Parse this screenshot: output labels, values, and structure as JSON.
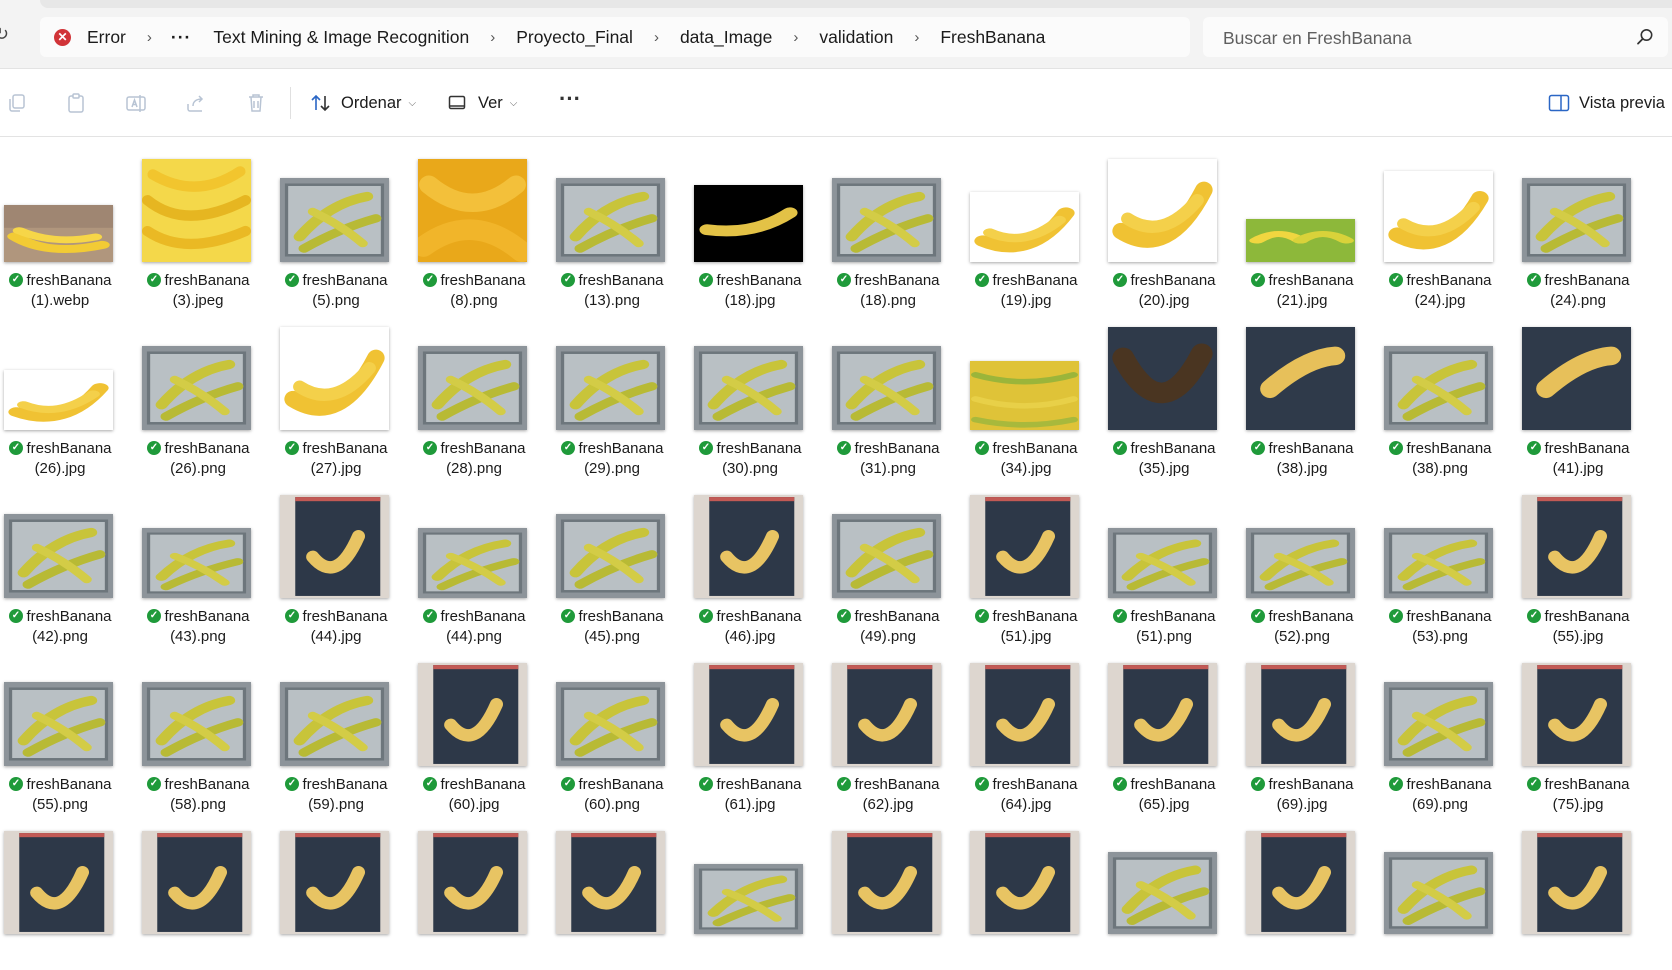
{
  "address_bar": {
    "error_label": "Error",
    "overflow": "···",
    "crumbs": [
      "Text Mining & Image Recognition",
      "Proyecto_Final",
      "data_Image",
      "validation",
      "FreshBanana"
    ]
  },
  "search": {
    "placeholder": "Buscar en FreshBanana"
  },
  "toolbar": {
    "sort_label": "Ordenar",
    "view_label": "Ver",
    "more_label": "···",
    "preview_label": "Vista previa"
  },
  "files": [
    {
      "n1": "freshBanana",
      "n2": "(1).webp",
      "type": "wood",
      "h": 0.55
    },
    {
      "n1": "freshBanana",
      "n2": "(3).jpeg",
      "type": "bunch",
      "h": 1
    },
    {
      "n1": "freshBanana",
      "n2": "(5).png",
      "type": "tray",
      "h": 0.82
    },
    {
      "n1": "freshBanana",
      "n2": "(8).png",
      "type": "closeup",
      "h": 1
    },
    {
      "n1": "freshBanana",
      "n2": "(13).png",
      "type": "tray",
      "h": 0.82
    },
    {
      "n1": "freshBanana",
      "n2": "(18).jpg",
      "type": "black",
      "h": 0.75
    },
    {
      "n1": "freshBanana",
      "n2": "(18).png",
      "type": "tray",
      "h": 0.82
    },
    {
      "n1": "freshBanana",
      "n2": "(19).jpg",
      "type": "white",
      "h": 0.68
    },
    {
      "n1": "freshBanana",
      "n2": "(20).jpg",
      "type": "white",
      "h": 1
    },
    {
      "n1": "freshBanana",
      "n2": "(21).jpg",
      "type": "green",
      "h": 0.42
    },
    {
      "n1": "freshBanana",
      "n2": "(24).jpg",
      "type": "white",
      "h": 0.88
    },
    {
      "n1": "freshBanana",
      "n2": "(24).png",
      "type": "tray",
      "h": 0.82
    },
    {
      "n1": "freshBanana",
      "n2": "(26).jpg",
      "type": "white",
      "h": 0.58
    },
    {
      "n1": "freshBanana",
      "n2": "(26).png",
      "type": "tray",
      "h": 0.82
    },
    {
      "n1": "freshBanana",
      "n2": "(27).jpg",
      "type": "white",
      "h": 1
    },
    {
      "n1": "freshBanana",
      "n2": "(28).png",
      "type": "tray",
      "h": 0.82
    },
    {
      "n1": "freshBanana",
      "n2": "(29).png",
      "type": "tray",
      "h": 0.82
    },
    {
      "n1": "freshBanana",
      "n2": "(30).png",
      "type": "tray",
      "h": 0.82
    },
    {
      "n1": "freshBanana",
      "n2": "(31).png",
      "type": "tray",
      "h": 0.82
    },
    {
      "n1": "freshBanana",
      "n2": "(34).jpg",
      "type": "pile",
      "h": 0.67
    },
    {
      "n1": "freshBanana",
      "n2": "(35).jpg",
      "type": "darkripe",
      "h": 1
    },
    {
      "n1": "freshBanana",
      "n2": "(38).jpg",
      "type": "dark",
      "h": 1
    },
    {
      "n1": "freshBanana",
      "n2": "(38).png",
      "type": "tray",
      "h": 0.82
    },
    {
      "n1": "freshBanana",
      "n2": "(41).jpg",
      "type": "dark",
      "h": 1
    },
    {
      "n1": "freshBanana",
      "n2": "(42).png",
      "type": "tray",
      "h": 0.82
    },
    {
      "n1": "freshBanana",
      "n2": "(43).png",
      "type": "tray",
      "h": 0.68
    },
    {
      "n1": "freshBanana",
      "n2": "(44).jpg",
      "type": "notebook",
      "h": 1
    },
    {
      "n1": "freshBanana",
      "n2": "(44).png",
      "type": "tray",
      "h": 0.68
    },
    {
      "n1": "freshBanana",
      "n2": "(45).png",
      "type": "tray",
      "h": 0.82
    },
    {
      "n1": "freshBanana",
      "n2": "(46).jpg",
      "type": "notebook",
      "h": 1
    },
    {
      "n1": "freshBanana",
      "n2": "(49).png",
      "type": "tray",
      "h": 0.82
    },
    {
      "n1": "freshBanana",
      "n2": "(51).jpg",
      "type": "notebook",
      "h": 1
    },
    {
      "n1": "freshBanana",
      "n2": "(51).png",
      "type": "tray",
      "h": 0.68
    },
    {
      "n1": "freshBanana",
      "n2": "(52).png",
      "type": "tray",
      "h": 0.68
    },
    {
      "n1": "freshBanana",
      "n2": "(53).png",
      "type": "tray",
      "h": 0.68
    },
    {
      "n1": "freshBanana",
      "n2": "(55).jpg",
      "type": "notebook",
      "h": 1
    },
    {
      "n1": "freshBanana",
      "n2": "(55).png",
      "type": "tray",
      "h": 0.82
    },
    {
      "n1": "freshBanana",
      "n2": "(58).png",
      "type": "tray",
      "h": 0.82
    },
    {
      "n1": "freshBanana",
      "n2": "(59).png",
      "type": "tray",
      "h": 0.82
    },
    {
      "n1": "freshBanana",
      "n2": "(60).jpg",
      "type": "notebook",
      "h": 1
    },
    {
      "n1": "freshBanana",
      "n2": "(60).png",
      "type": "tray",
      "h": 0.82
    },
    {
      "n1": "freshBanana",
      "n2": "(61).jpg",
      "type": "notebook",
      "h": 1
    },
    {
      "n1": "freshBanana",
      "n2": "(62).jpg",
      "type": "notebook",
      "h": 1
    },
    {
      "n1": "freshBanana",
      "n2": "(64).jpg",
      "type": "notebook",
      "h": 1
    },
    {
      "n1": "freshBanana",
      "n2": "(65).jpg",
      "type": "notebook",
      "h": 1
    },
    {
      "n1": "freshBanana",
      "n2": "(69).jpg",
      "type": "notebook",
      "h": 1
    },
    {
      "n1": "freshBanana",
      "n2": "(69).png",
      "type": "tray",
      "h": 0.82
    },
    {
      "n1": "freshBanana",
      "n2": "(75).jpg",
      "type": "notebook",
      "h": 1
    },
    {
      "n1": "",
      "n2": "",
      "type": "notebook",
      "h": 1
    },
    {
      "n1": "",
      "n2": "",
      "type": "notebook",
      "h": 1
    },
    {
      "n1": "",
      "n2": "",
      "type": "notebook",
      "h": 1
    },
    {
      "n1": "",
      "n2": "",
      "type": "notebook",
      "h": 1
    },
    {
      "n1": "",
      "n2": "",
      "type": "notebook",
      "h": 1
    },
    {
      "n1": "",
      "n2": "",
      "type": "tray",
      "h": 0.68
    },
    {
      "n1": "",
      "n2": "",
      "type": "notebook",
      "h": 1
    },
    {
      "n1": "",
      "n2": "",
      "type": "notebook",
      "h": 1
    },
    {
      "n1": "",
      "n2": "",
      "type": "tray",
      "h": 0.8
    },
    {
      "n1": "",
      "n2": "",
      "type": "notebook",
      "h": 1
    },
    {
      "n1": "",
      "n2": "",
      "type": "tray",
      "h": 0.8
    },
    {
      "n1": "",
      "n2": "",
      "type": "notebook",
      "h": 1
    }
  ]
}
